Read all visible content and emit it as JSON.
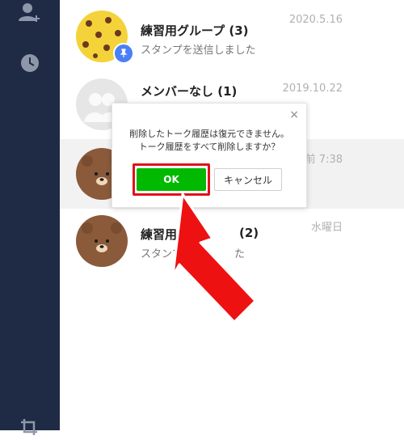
{
  "chats": [
    {
      "name": "練習用グループ",
      "count": "(3)",
      "message": "スタンプを送信しました",
      "date": "2020.5.16",
      "avatar": "yellow-bear-pattern-avatar",
      "pinned": true
    },
    {
      "name": "メンバーなし",
      "count": "(1)",
      "message": "",
      "date": "2019.10.22",
      "avatar": "default-group-avatar",
      "pinned": false
    },
    {
      "name": "",
      "count": "",
      "message": "",
      "date": "前 7:38",
      "avatar": "brown-bear-avatar",
      "pinned": false
    },
    {
      "name": "練習用",
      "count": "(2)",
      "message": "スタンプ",
      "message_tail": "た",
      "name_tail": "",
      "date": "水曜日",
      "avatar": "brown-bear-avatar",
      "pinned": false
    }
  ],
  "dialog": {
    "message_line1": "削除したトーク履歴は復元できません。",
    "message_line2": "トーク履歴をすべて削除しますか？",
    "ok_label": "OK",
    "cancel_label": "キャンセル",
    "close_label": "×"
  },
  "colors": {
    "sidebar": "#1f2b45",
    "ok_green": "#00b900",
    "highlight_red": "#e0111b",
    "pin_blue": "#4a7ff7"
  },
  "icons": {
    "sidebar": [
      "add-friend-icon",
      "clock-icon",
      "crop-icon"
    ]
  }
}
